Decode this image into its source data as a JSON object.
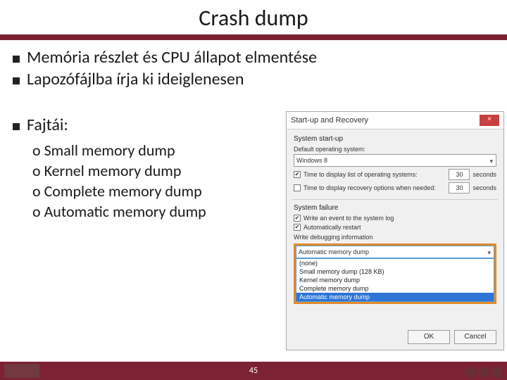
{
  "title": "Crash dump",
  "bullets": {
    "b1": "Memória részlet és CPU állapot elmentése",
    "b2": "Lapozófájlba írja ki ideiglenesen",
    "b3": "Fajtái:"
  },
  "sub": {
    "s1": "Small memory dump",
    "s2": "Kernel memory dump",
    "s3": "Complete memory dump",
    "s4": "Automatic memory dump"
  },
  "dialog": {
    "title": "Start-up and Recovery",
    "close": "×",
    "group1": "System start-up",
    "defaultOsLabel": "Default operating system:",
    "defaultOs": "Windows 8",
    "timeList": "Time to display list of operating systems:",
    "timeRecovery": "Time to display recovery options when needed:",
    "seconds": "seconds",
    "spin1": "30",
    "spin2": "30",
    "group2": "System failure",
    "writeEvent": "Write an event to the system log",
    "autoRestart": "Automatically restart",
    "writeDebug": "Write debugging information",
    "selected": "Automatic memory dump",
    "opts": {
      "o1": "(none)",
      "o2": "Small memory dump (128 KB)",
      "o3": "Kernel memory dump",
      "o4": "Complete memory dump",
      "o5": "Automatic memory dump"
    },
    "ok": "OK",
    "cancel": "Cancel"
  },
  "pageNumber": "45"
}
